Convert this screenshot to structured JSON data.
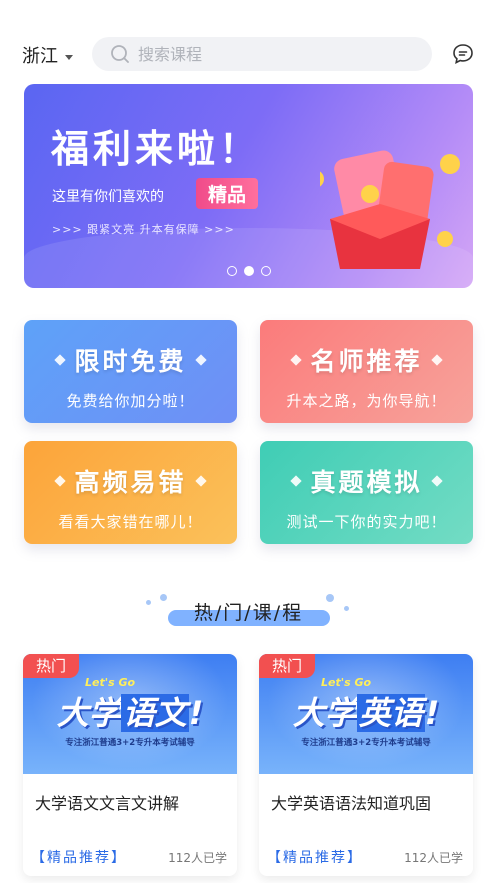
{
  "header": {
    "region": "浙江",
    "search_placeholder": "搜索课程"
  },
  "banner": {
    "title": "福利来啦！",
    "subtitle": "这里有你们喜欢的",
    "tag": "精品",
    "slogan": ">>> 跟紧文亮  升本有保障 >>>",
    "slide_count": 3,
    "active_slide": 2
  },
  "features": [
    {
      "title": "限时免费",
      "subtitle": "免费给你加分啦！"
    },
    {
      "title": "名师推荐",
      "subtitle": "升本之路，为你导航！"
    },
    {
      "title": "高频易错",
      "subtitle": "看看大家错在哪儿！"
    },
    {
      "title": "真题模拟",
      "subtitle": "测试一下你的实力吧！"
    }
  ],
  "section": {
    "title": "热/门/课/程"
  },
  "courses": [
    {
      "hot_label": "热门",
      "cover_tag": "Let's Go",
      "cover_title_prefix": "大学",
      "cover_title_highlight": "语文",
      "cover_title_suffix": "!",
      "cover_subtitle": "专注浙江普通3+2专升本考试辅导",
      "name": "大学语文文言文讲解",
      "badge": "【精品推荐】",
      "learners": "112人已学"
    },
    {
      "hot_label": "热门",
      "cover_tag": "Let's Go",
      "cover_title_prefix": "大学",
      "cover_title_highlight": "英语",
      "cover_title_suffix": "!",
      "cover_subtitle": "专注浙江普通3+2专升本考试辅导",
      "name": "大学英语语法知道巩固",
      "badge": "【精品推荐】",
      "learners": "112人已学"
    }
  ],
  "colors": {
    "accent_blue": "#2b6be6",
    "hot_red": "#f25050"
  }
}
